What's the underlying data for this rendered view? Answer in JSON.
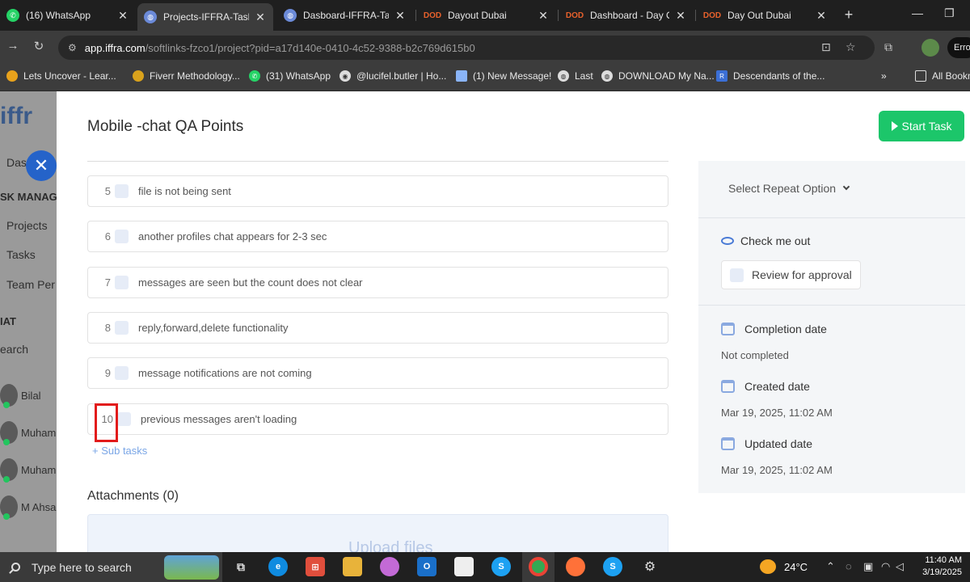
{
  "browser": {
    "tabs": [
      {
        "title": "(16) WhatsApp",
        "icon": "whatsapp-icon"
      },
      {
        "title": "Projects-IFFRA-Task P",
        "icon": "globe-icon",
        "active": true
      },
      {
        "title": "Dasboard-IFFRA-Task",
        "icon": "globe-icon"
      },
      {
        "title": "Dayout Dubai",
        "icon": "dayout-icon"
      },
      {
        "title": "Dashboard - Day Out",
        "icon": "dayout-icon"
      },
      {
        "title": "Day Out Dubai",
        "icon": "dayout-icon"
      }
    ],
    "url_host": "app.iffra.com",
    "url_path": "/softlinks-fzco1/project?pid=a17d140e-0410-4c52-9388-b2c769d615b0",
    "profile_label": "Erro",
    "bookmarks": [
      "Lets Uncover - Lear...",
      "Fiverr Methodology...",
      "(31) WhatsApp",
      "@lucifel.butler | Ho...",
      "(1) New Message!",
      "Last",
      "DOWNLOAD My Na...",
      "Descendants of the..."
    ],
    "all_bookmarks": "All Bookm",
    "more_bookmarks": "»",
    "new_tab": "+"
  },
  "sidebar": {
    "logo": "iffr",
    "items": [
      {
        "label": "Das",
        "kind": "item"
      },
      {
        "label": "SK MANAG",
        "kind": "head"
      },
      {
        "label": "Projects",
        "kind": "item"
      },
      {
        "label": "Tasks",
        "kind": "item"
      },
      {
        "label": "Team Per",
        "kind": "item"
      },
      {
        "label": "IAT",
        "kind": "head"
      },
      {
        "label": "earch",
        "kind": "item"
      }
    ],
    "users": [
      "Bilal",
      "Muhamm",
      "Muhamm",
      "M Ahsan"
    ]
  },
  "task": {
    "title": "Mobile -chat QA Points",
    "start_button": "Start Task",
    "subtasks": [
      {
        "num": "5",
        "text": "file is not being sent"
      },
      {
        "num": "6",
        "text": "another profiles chat appears for 2-3 sec"
      },
      {
        "num": "7",
        "text": "messages are seen but the count does not clear"
      },
      {
        "num": "8",
        "text": "reply,forward,delete functionality"
      },
      {
        "num": "9",
        "text": "message notifications are not coming"
      },
      {
        "num": "10",
        "text": "previous messages aren't loading"
      }
    ],
    "add_subtask": "+ Sub tasks",
    "attachments_title": "Attachments (0)",
    "upload_label": "Upload files"
  },
  "panel": {
    "repeat_select": "Select Repeat Option",
    "check_me_out": "Check me out",
    "review_label": "Review for approval",
    "completion_label": "Completion date",
    "completion_value": "Not completed",
    "created_label": "Created date",
    "created_value": "Mar 19, 2025, 11:02 AM",
    "updated_label": "Updated date",
    "updated_value": "Mar 19, 2025, 11:02 AM"
  },
  "taskbar": {
    "search_placeholder": "Type here to search",
    "temperature": "24°C",
    "time": "11:40 AM",
    "date": "3/19/2025"
  },
  "colors": {
    "start_button": "#1cc66a",
    "accent": "#2563c9",
    "highlight": "#e21b1b"
  }
}
